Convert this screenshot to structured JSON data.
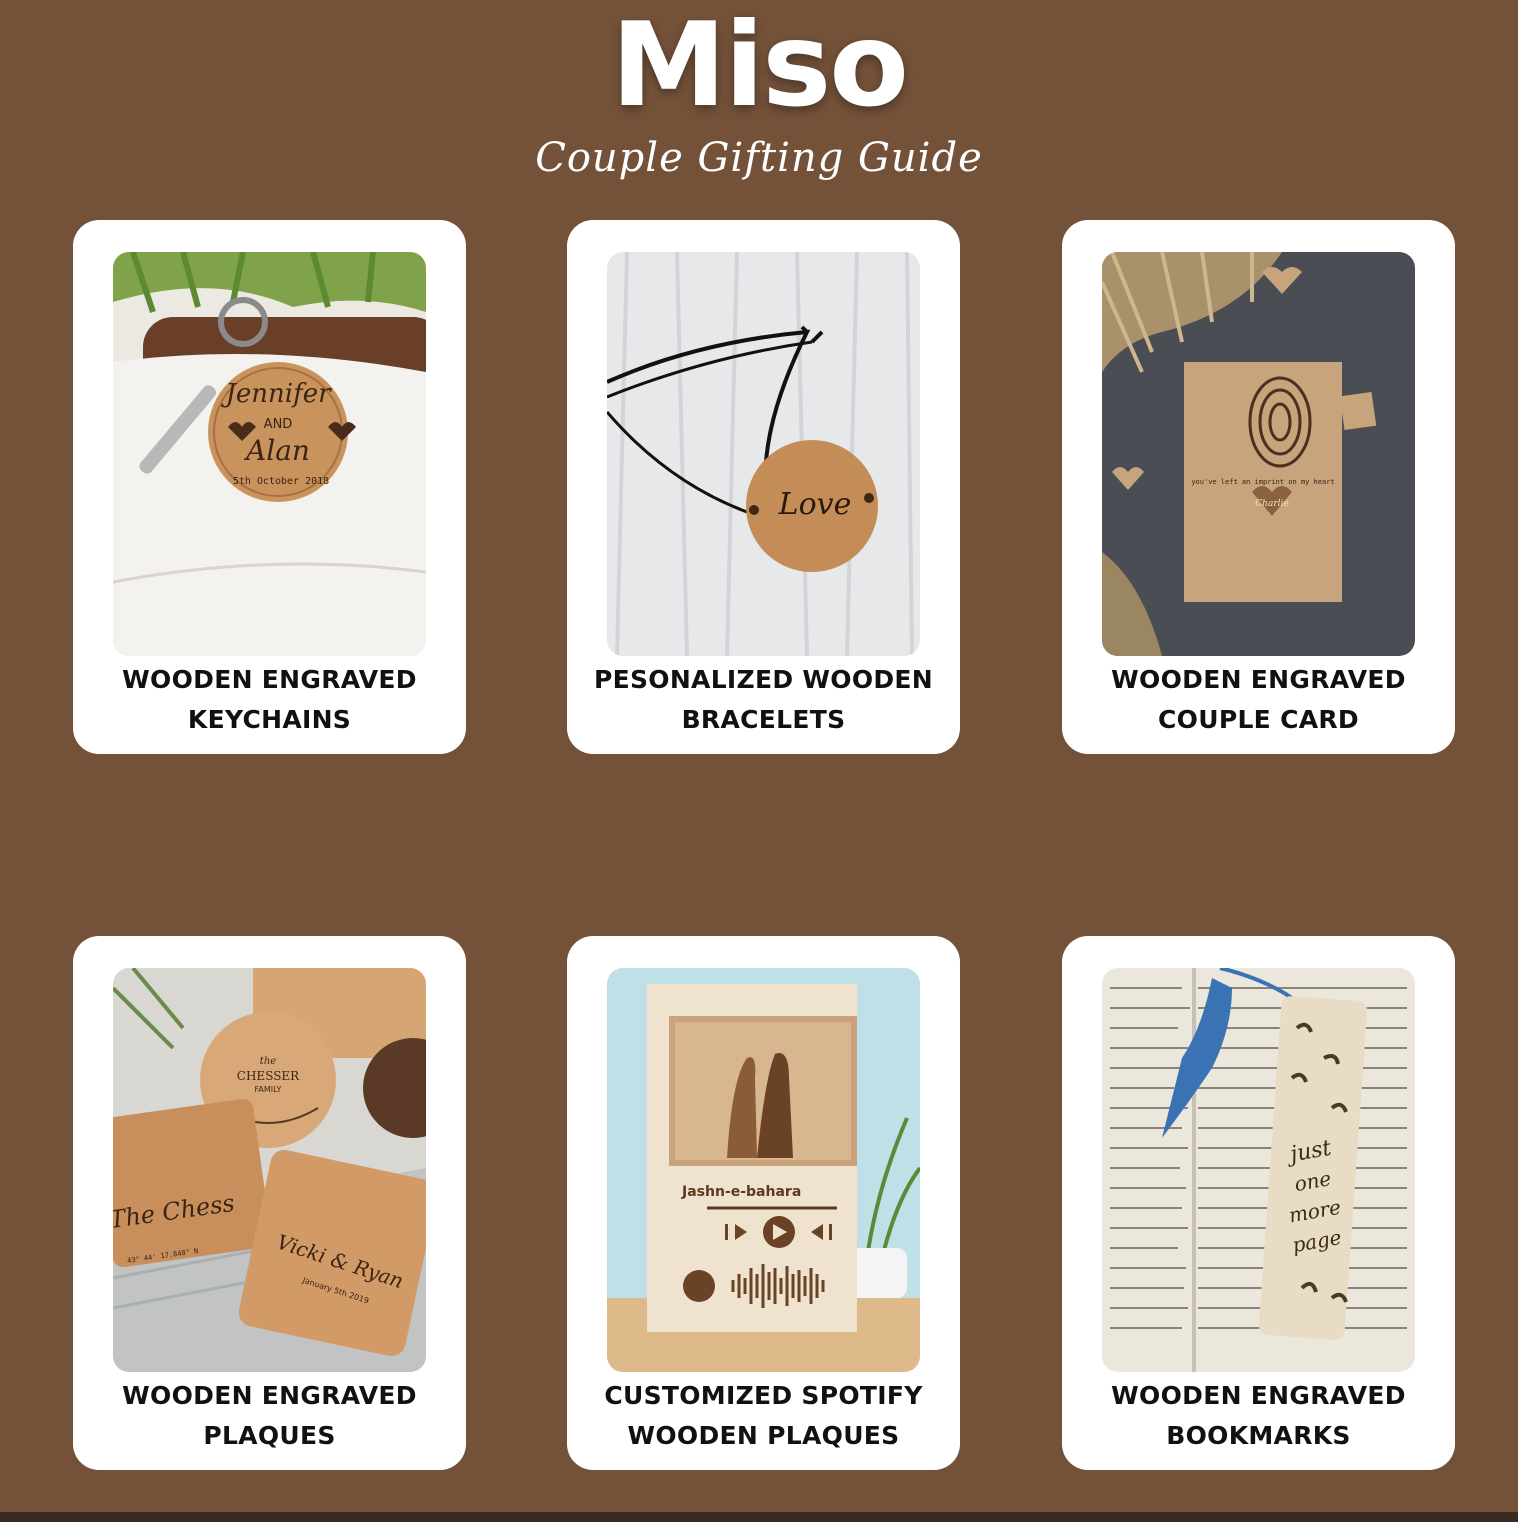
{
  "header": {
    "title": "Miso",
    "subtitle": "Couple Gifting Guide"
  },
  "colors": {
    "background": "#74523a",
    "card": "#ffffff",
    "caption_text": "#111111"
  },
  "cards": [
    {
      "line1": "WOODEN ENGRAVED",
      "line2": "KEYCHAINS",
      "photo_text": {
        "name1": "Jennifer",
        "conj": "AND",
        "name2": "Alan",
        "date": "5th October 2018"
      }
    },
    {
      "line1": "PESONALIZED WOODEN",
      "line2": "BRACELETS",
      "photo_text": {
        "word": "Love"
      }
    },
    {
      "line1": "WOODEN ENGRAVED",
      "line2": "COUPLE CARD",
      "photo_text": {
        "message": "you've left an imprint on my heart",
        "name": "Charlie"
      }
    },
    {
      "line1": "WOODEN ENGRAVED",
      "line2": "PLAQUES",
      "photo_text": {
        "small": "the",
        "family": "CHESSER",
        "family2": "FAMILY",
        "script1": "The Chess",
        "script2": "Vicki & Ryan",
        "date": "January 5th 2019",
        "coords": "43° 44' 17.840\" N"
      }
    },
    {
      "line1": "CUSTOMIZED SPOTIFY",
      "line2": "WOODEN PLAQUES",
      "photo_text": {
        "song": "Jashn-e-bahara"
      }
    },
    {
      "line1": "WOODEN ENGRAVED",
      "line2": "BOOKMARKS",
      "photo_text": {
        "w1": "just",
        "w2": "one",
        "w3": "more",
        "w4": "page"
      }
    }
  ]
}
